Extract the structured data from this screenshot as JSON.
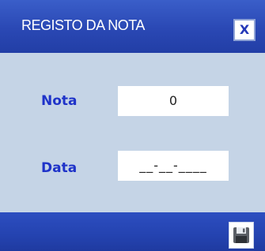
{
  "window": {
    "title": "REGISTO DA NOTA",
    "close_label": "X",
    "close_icon": "close-icon"
  },
  "form": {
    "nota": {
      "label": "Nota",
      "value": "0"
    },
    "data": {
      "label": "Data",
      "value": "__-__-____"
    }
  },
  "footer": {
    "save_icon": "floppy-disk-icon"
  },
  "colors": {
    "titlebar": "#2a48b4",
    "body": "#c5d4e6",
    "label": "#1f33c9",
    "footer": "#2443b0"
  }
}
